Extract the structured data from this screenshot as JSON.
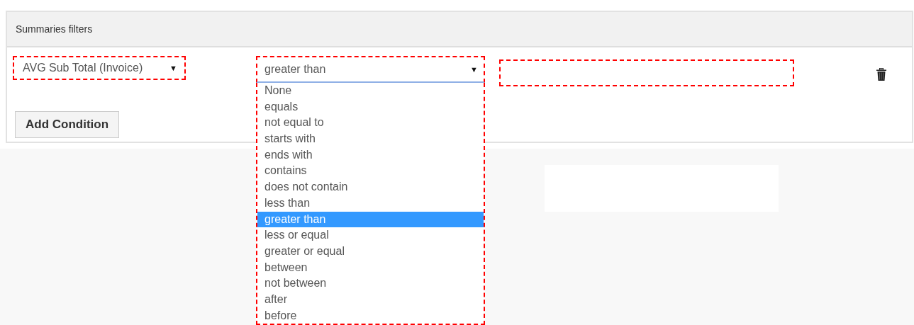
{
  "panel": {
    "title": "Summaries filters"
  },
  "condition": {
    "field": {
      "value": "AVG Sub Total (Invoice)",
      "arrow": "▼"
    },
    "operator": {
      "value": "greater than",
      "arrow": "▼",
      "expanded": true,
      "options": [
        {
          "label": "None",
          "selected": false
        },
        {
          "label": "equals",
          "selected": false
        },
        {
          "label": "not equal to",
          "selected": false
        },
        {
          "label": "starts with",
          "selected": false
        },
        {
          "label": "ends with",
          "selected": false
        },
        {
          "label": "contains",
          "selected": false
        },
        {
          "label": "does not contain",
          "selected": false
        },
        {
          "label": "less than",
          "selected": false
        },
        {
          "label": "greater than",
          "selected": true
        },
        {
          "label": "less or equal",
          "selected": false
        },
        {
          "label": "greater or equal",
          "selected": false
        },
        {
          "label": "between",
          "selected": false
        },
        {
          "label": "not between",
          "selected": false
        },
        {
          "label": "after",
          "selected": false
        },
        {
          "label": "before",
          "selected": false
        }
      ]
    }
  },
  "add_button": "Add Condition"
}
